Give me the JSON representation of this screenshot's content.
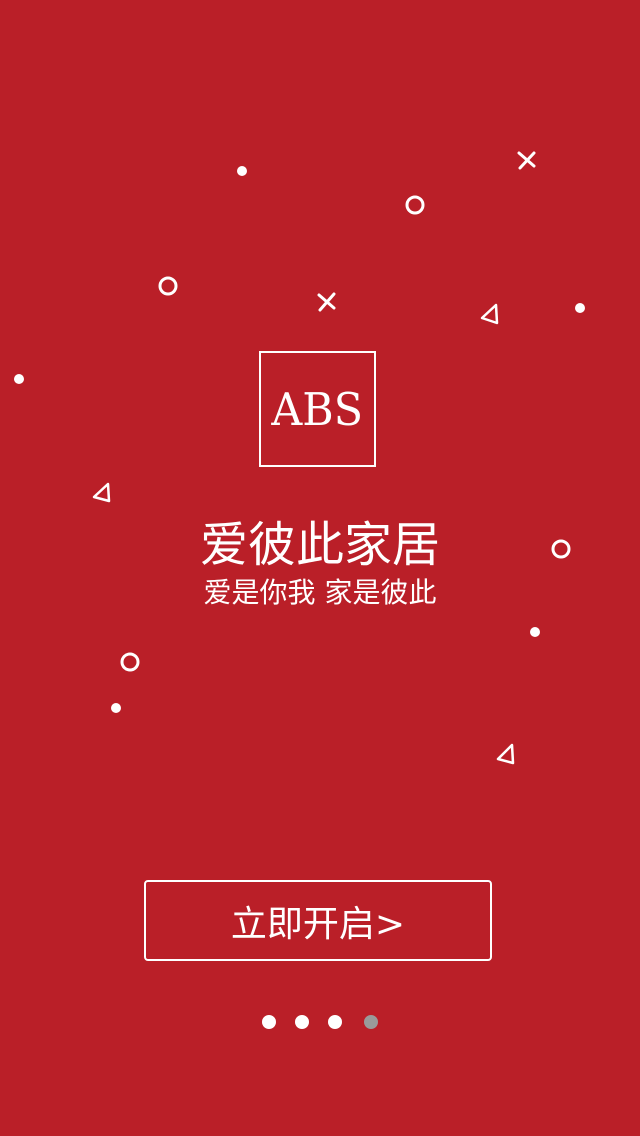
{
  "colors": {
    "background": "#ba1f28",
    "foreground": "#ffffff",
    "pager_active": "#ffffff",
    "pager_inactive": "#9a9a9a"
  },
  "logo": {
    "text": "ABS"
  },
  "title": "爱彼此家居",
  "subtitle": "爱是你我 家是彼此",
  "start_button": {
    "label": "立即开启>"
  },
  "pager": {
    "page_count": 4,
    "current_page": 4
  },
  "decorations": {
    "icons": [
      "dot-icon",
      "ring-icon",
      "cross-icon",
      "triangle-icon"
    ]
  }
}
